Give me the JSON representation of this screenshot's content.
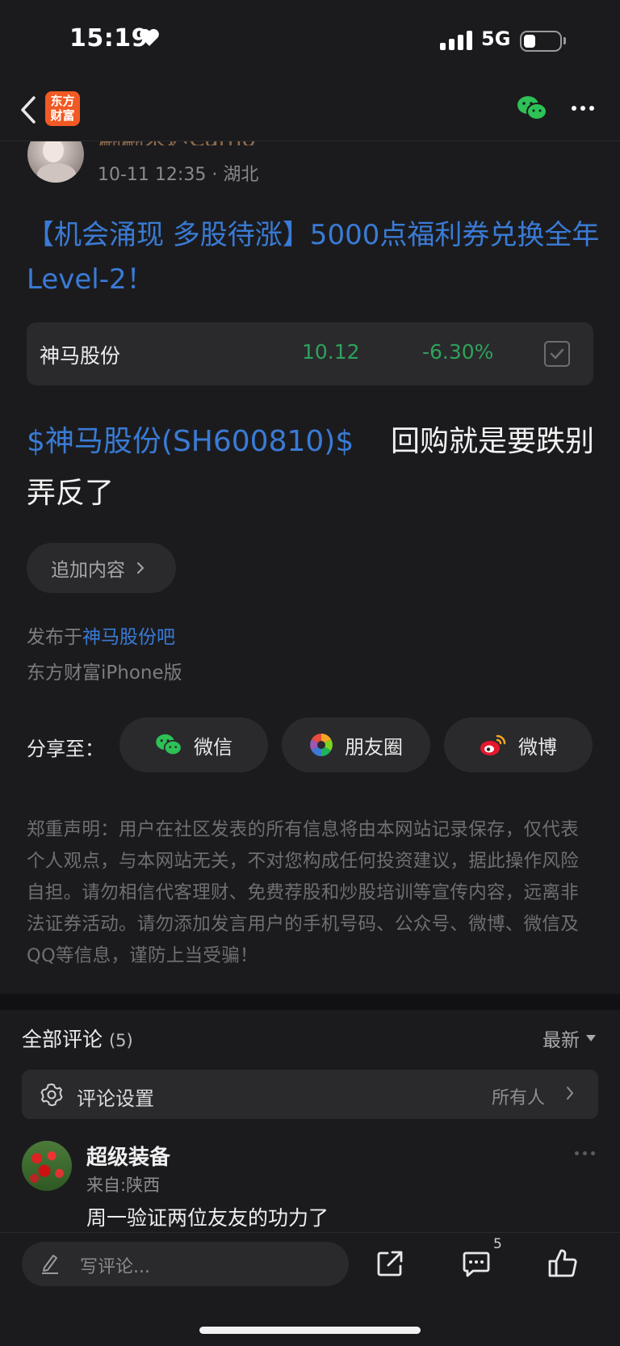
{
  "status_bar": {
    "time": "15:19",
    "network": "5G"
  },
  "nav": {
    "logo_line1": "东方",
    "logo_line2": "财富"
  },
  "post": {
    "author_name": "翩翩来迟Carno",
    "time": "10-11 12:35",
    "location": "湖北",
    "title": "【机会涌现 多股待涨】5000点福利券兑换全年Level-2！",
    "stock_card": {
      "name": "神马股份",
      "price": "10.12",
      "change": "-6.30%"
    },
    "body_link": "$神马股份(SH600810)$",
    "body_text": "回购就是要跌别弄反了",
    "append_label": "追加内容",
    "posted_prefix": "发布于",
    "posted_bar": "神马股份吧",
    "client": "东方财富iPhone版",
    "share_label": "分享至：",
    "share_options": [
      "微信",
      "朋友圈",
      "微博"
    ],
    "disclaimer": "郑重声明：用户在社区发表的所有信息将由本网站记录保存，仅代表个人观点，与本网站无关，不对您构成任何投资建议，据此操作风险自担。请勿相信代客理财、免费荐股和炒股培训等宣传内容，远离非法证券活动。请勿添加发言用户的手机号码、公众号、微博、微信及QQ等信息，谨防上当受骗！"
  },
  "comments": {
    "title": "全部评论",
    "count": "(5)",
    "sort": "最新",
    "settings_label": "评论设置",
    "settings_value": "所有人",
    "items": [
      {
        "name": "超级装备",
        "from": "来自:陕西",
        "text": "周一验证两位友友的功力了"
      }
    ]
  },
  "bottom_bar": {
    "placeholder": "写评论...",
    "comment_count": "5"
  },
  "colors": {
    "accent_blue": "#3a7bd5",
    "down_green": "#2ea25a",
    "brand_orange": "#f15a24",
    "background": "#1b1b1e"
  }
}
